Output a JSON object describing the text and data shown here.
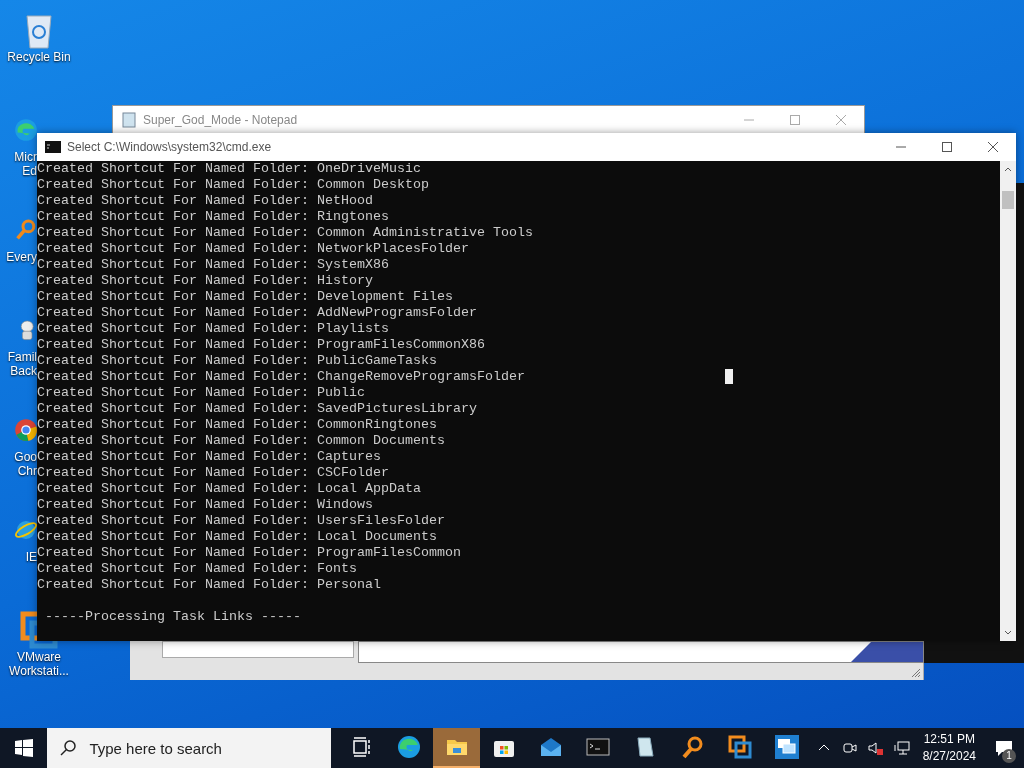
{
  "desktop_icons": [
    {
      "kind": "recycle-bin",
      "label_lines": [
        "Recycle Bin"
      ],
      "clipped": false
    },
    {
      "kind": "edge",
      "label_lines": [
        "Micr",
        "Ed"
      ],
      "clipped": true
    },
    {
      "kind": "everything",
      "label_lines": [
        "Every"
      ],
      "clipped": true
    },
    {
      "kind": "family",
      "label_lines": [
        "Famil",
        "Back"
      ],
      "clipped": true
    },
    {
      "kind": "chrome",
      "label_lines": [
        "Goo",
        "Chr"
      ],
      "clipped": true
    },
    {
      "kind": "ie",
      "label_lines": [
        "IE"
      ],
      "clipped": true
    },
    {
      "kind": "vmware",
      "label_lines": [
        "VMware",
        "Workstati..."
      ],
      "clipped": false
    }
  ],
  "notepad": {
    "title": "Super_God_Mode - Notepad"
  },
  "console": {
    "title": "Select C:\\Windows\\system32\\cmd.exe",
    "lines": [
      "Created Shortcut For Named Folder: OneDriveMusic",
      "Created Shortcut For Named Folder: Common Desktop",
      "Created Shortcut For Named Folder: NetHood",
      "Created Shortcut For Named Folder: Ringtones",
      "Created Shortcut For Named Folder: Common Administrative Tools",
      "Created Shortcut For Named Folder: NetworkPlacesFolder",
      "Created Shortcut For Named Folder: SystemX86",
      "Created Shortcut For Named Folder: History",
      "Created Shortcut For Named Folder: Development Files",
      "Created Shortcut For Named Folder: AddNewProgramsFolder",
      "Created Shortcut For Named Folder: Playlists",
      "Created Shortcut For Named Folder: ProgramFilesCommonX86",
      "Created Shortcut For Named Folder: PublicGameTasks",
      "Created Shortcut For Named Folder: ChangeRemoveProgramsFolder",
      "Created Shortcut For Named Folder: Public",
      "Created Shortcut For Named Folder: SavedPicturesLibrary",
      "Created Shortcut For Named Folder: CommonRingtones",
      "Created Shortcut For Named Folder: Common Documents",
      "Created Shortcut For Named Folder: Captures",
      "Created Shortcut For Named Folder: CSCFolder",
      "Created Shortcut For Named Folder: Local AppData",
      "Created Shortcut For Named Folder: Windows",
      "Created Shortcut For Named Folder: UsersFilesFolder",
      "Created Shortcut For Named Folder: Local Documents",
      "Created Shortcut For Named Folder: ProgramFilesCommon",
      "Created Shortcut For Named Folder: Fonts",
      "Created Shortcut For Named Folder: Personal"
    ],
    "footer": " -----Processing Task Links -----"
  },
  "taskbar": {
    "search": {
      "placeholder": "Type here to search"
    },
    "apps": [
      {
        "kind": "task-view",
        "active": false
      },
      {
        "kind": "edge",
        "active": false
      },
      {
        "kind": "folder",
        "active": true
      },
      {
        "kind": "store",
        "active": false
      },
      {
        "kind": "mail",
        "active": false
      },
      {
        "kind": "terminal",
        "active": false
      },
      {
        "kind": "notepad",
        "active": false
      },
      {
        "kind": "magnifier",
        "active": false
      },
      {
        "kind": "vmware",
        "active": false
      },
      {
        "kind": "remote-desktop",
        "active": false
      }
    ],
    "time": "12:51 PM",
    "date": "8/27/2024",
    "notification_count": "1"
  }
}
